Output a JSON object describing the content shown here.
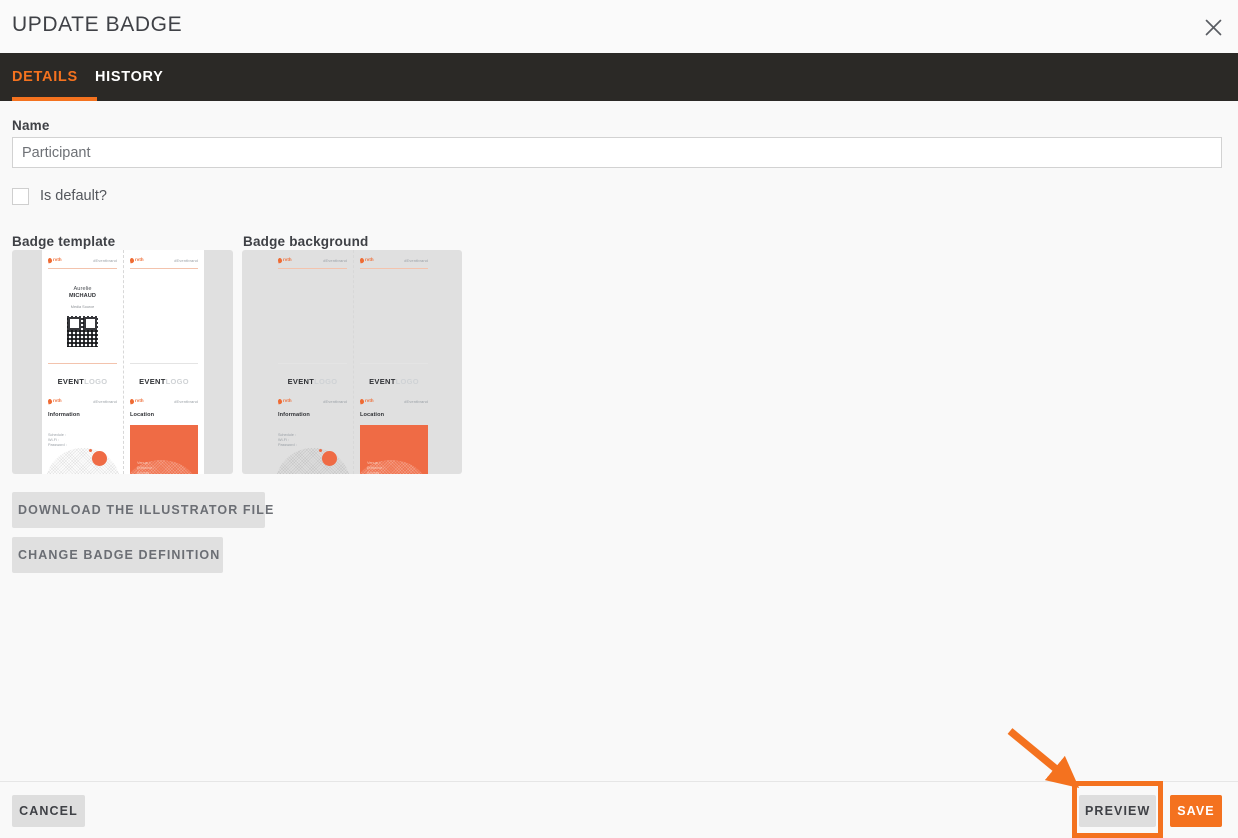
{
  "header": {
    "title": "UPDATE BADGE",
    "close_icon": "close-icon"
  },
  "tabs": [
    {
      "label": "DETAILS",
      "active": true
    },
    {
      "label": "HISTORY",
      "active": false
    }
  ],
  "form": {
    "name_label": "Name",
    "name_value": "Participant",
    "name_placeholder": "Name",
    "is_default_label": "Is default?",
    "is_default_checked": false
  },
  "previews": {
    "template_label": "Badge template",
    "background_label": "Badge background",
    "badge": {
      "brand_word": "rvth",
      "brand_right": "#Eventbrand",
      "attendee_first": "Aurelie",
      "attendee_last": "MICHAUD",
      "attendee_sub": "Media Source",
      "event_logo_bold": "EVENT",
      "event_logo_light": "LOGO",
      "info_title": "Information",
      "info_lines": "Schedule :\nWi-Fi :\nPassword :",
      "location_title": "Location",
      "location_lines": "Venue :\nEntrance :\nAccess :\nParking :"
    }
  },
  "actions": {
    "download_label": "DOWNLOAD THE ILLUSTRATOR FILE",
    "change_label": "CHANGE BADGE DEFINITION"
  },
  "footer": {
    "cancel_label": "CANCEL",
    "preview_label": "PREVIEW",
    "save_label": "SAVE"
  },
  "annotation": {
    "color": "#f4721f",
    "target": "PREVIEW"
  },
  "colors": {
    "accent": "#f4721f",
    "tabbar": "#2b2926",
    "page_bg": "#f9f9f9",
    "panel_bg": "#e0e0e0",
    "badge_orange": "#ef6b45"
  }
}
